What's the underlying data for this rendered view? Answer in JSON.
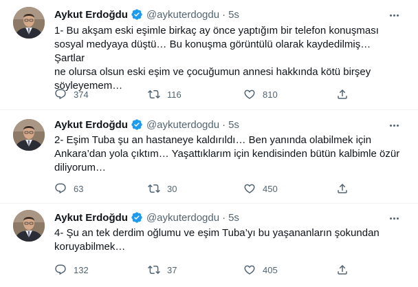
{
  "tweets": [
    {
      "author_name": "Aykut Erdoğdu",
      "handle": "@aykuterdogdu",
      "time": "5s",
      "lines": [
        "1- Bu akşam eski eşimle birkaç ay önce yaptığım bir telefon konuşması",
        "sosyal medyaya düştü… Bu konuşma görüntülü olarak kaydedilmiş… Şartlar",
        "ne olursa olsun eski eşim ve çocuğumun annesi hakkında kötü birşey",
        "söyleyemem…"
      ],
      "replies": "374",
      "retweets": "116",
      "likes": "810"
    },
    {
      "author_name": "Aykut Erdoğdu",
      "handle": "@aykuterdogdu",
      "time": "5s",
      "lines": [
        "2- Eşim Tuba şu an hastaneye kaldırıldı… Ben yanında olabilmek için",
        "Ankara’dan yola çıktım… Yaşattıklarım için kendisinden bütün kalbimle özür",
        "diliyorum…"
      ],
      "replies": "63",
      "retweets": "30",
      "likes": "450"
    },
    {
      "author_name": "Aykut Erdoğdu",
      "handle": "@aykuterdogdu",
      "time": "5s",
      "lines": [
        "4- Şu an tek derdim oğlumu ve eşim Tuba’yı bu yaşananların şokundan",
        "koruyabilmek…"
      ],
      "replies": "132",
      "retweets": "37",
      "likes": "405"
    }
  ],
  "separator": "·",
  "icons": {
    "verified": "verified-badge-icon",
    "more": "more-options-icon",
    "reply": "reply-icon",
    "retweet": "retweet-icon",
    "like": "heart-icon",
    "share": "share-icon"
  },
  "colors": {
    "text": "#0f1419",
    "secondary": "#536471",
    "verified": "#1d9bf0",
    "divider": "#eff3f4"
  }
}
